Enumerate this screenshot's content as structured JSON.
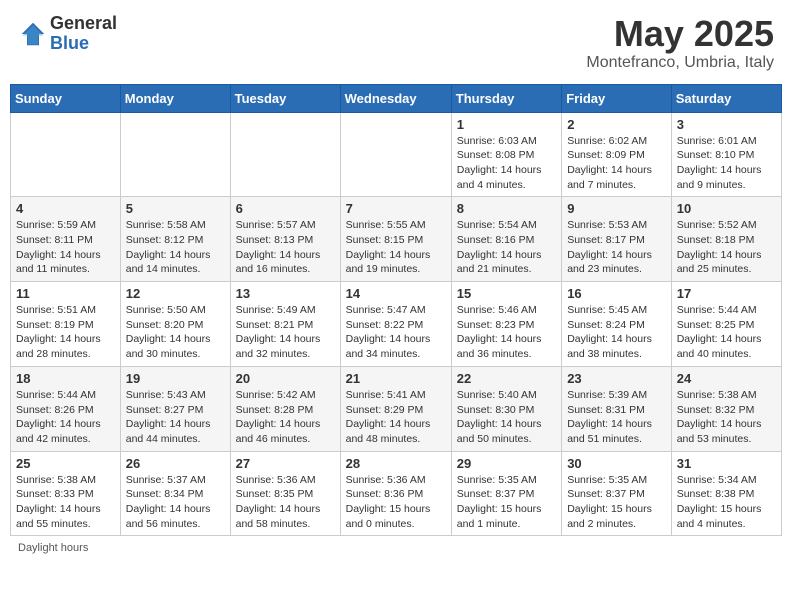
{
  "header": {
    "logo_general": "General",
    "logo_blue": "Blue",
    "title": "May 2025",
    "location": "Montefranco, Umbria, Italy"
  },
  "weekdays": [
    "Sunday",
    "Monday",
    "Tuesday",
    "Wednesday",
    "Thursday",
    "Friday",
    "Saturday"
  ],
  "weeks": [
    [
      {
        "day": "",
        "info": ""
      },
      {
        "day": "",
        "info": ""
      },
      {
        "day": "",
        "info": ""
      },
      {
        "day": "",
        "info": ""
      },
      {
        "day": "1",
        "info": "Sunrise: 6:03 AM\nSunset: 8:08 PM\nDaylight: 14 hours\nand 4 minutes."
      },
      {
        "day": "2",
        "info": "Sunrise: 6:02 AM\nSunset: 8:09 PM\nDaylight: 14 hours\nand 7 minutes."
      },
      {
        "day": "3",
        "info": "Sunrise: 6:01 AM\nSunset: 8:10 PM\nDaylight: 14 hours\nand 9 minutes."
      }
    ],
    [
      {
        "day": "4",
        "info": "Sunrise: 5:59 AM\nSunset: 8:11 PM\nDaylight: 14 hours\nand 11 minutes."
      },
      {
        "day": "5",
        "info": "Sunrise: 5:58 AM\nSunset: 8:12 PM\nDaylight: 14 hours\nand 14 minutes."
      },
      {
        "day": "6",
        "info": "Sunrise: 5:57 AM\nSunset: 8:13 PM\nDaylight: 14 hours\nand 16 minutes."
      },
      {
        "day": "7",
        "info": "Sunrise: 5:55 AM\nSunset: 8:15 PM\nDaylight: 14 hours\nand 19 minutes."
      },
      {
        "day": "8",
        "info": "Sunrise: 5:54 AM\nSunset: 8:16 PM\nDaylight: 14 hours\nand 21 minutes."
      },
      {
        "day": "9",
        "info": "Sunrise: 5:53 AM\nSunset: 8:17 PM\nDaylight: 14 hours\nand 23 minutes."
      },
      {
        "day": "10",
        "info": "Sunrise: 5:52 AM\nSunset: 8:18 PM\nDaylight: 14 hours\nand 25 minutes."
      }
    ],
    [
      {
        "day": "11",
        "info": "Sunrise: 5:51 AM\nSunset: 8:19 PM\nDaylight: 14 hours\nand 28 minutes."
      },
      {
        "day": "12",
        "info": "Sunrise: 5:50 AM\nSunset: 8:20 PM\nDaylight: 14 hours\nand 30 minutes."
      },
      {
        "day": "13",
        "info": "Sunrise: 5:49 AM\nSunset: 8:21 PM\nDaylight: 14 hours\nand 32 minutes."
      },
      {
        "day": "14",
        "info": "Sunrise: 5:47 AM\nSunset: 8:22 PM\nDaylight: 14 hours\nand 34 minutes."
      },
      {
        "day": "15",
        "info": "Sunrise: 5:46 AM\nSunset: 8:23 PM\nDaylight: 14 hours\nand 36 minutes."
      },
      {
        "day": "16",
        "info": "Sunrise: 5:45 AM\nSunset: 8:24 PM\nDaylight: 14 hours\nand 38 minutes."
      },
      {
        "day": "17",
        "info": "Sunrise: 5:44 AM\nSunset: 8:25 PM\nDaylight: 14 hours\nand 40 minutes."
      }
    ],
    [
      {
        "day": "18",
        "info": "Sunrise: 5:44 AM\nSunset: 8:26 PM\nDaylight: 14 hours\nand 42 minutes."
      },
      {
        "day": "19",
        "info": "Sunrise: 5:43 AM\nSunset: 8:27 PM\nDaylight: 14 hours\nand 44 minutes."
      },
      {
        "day": "20",
        "info": "Sunrise: 5:42 AM\nSunset: 8:28 PM\nDaylight: 14 hours\nand 46 minutes."
      },
      {
        "day": "21",
        "info": "Sunrise: 5:41 AM\nSunset: 8:29 PM\nDaylight: 14 hours\nand 48 minutes."
      },
      {
        "day": "22",
        "info": "Sunrise: 5:40 AM\nSunset: 8:30 PM\nDaylight: 14 hours\nand 50 minutes."
      },
      {
        "day": "23",
        "info": "Sunrise: 5:39 AM\nSunset: 8:31 PM\nDaylight: 14 hours\nand 51 minutes."
      },
      {
        "day": "24",
        "info": "Sunrise: 5:38 AM\nSunset: 8:32 PM\nDaylight: 14 hours\nand 53 minutes."
      }
    ],
    [
      {
        "day": "25",
        "info": "Sunrise: 5:38 AM\nSunset: 8:33 PM\nDaylight: 14 hours\nand 55 minutes."
      },
      {
        "day": "26",
        "info": "Sunrise: 5:37 AM\nSunset: 8:34 PM\nDaylight: 14 hours\nand 56 minutes."
      },
      {
        "day": "27",
        "info": "Sunrise: 5:36 AM\nSunset: 8:35 PM\nDaylight: 14 hours\nand 58 minutes."
      },
      {
        "day": "28",
        "info": "Sunrise: 5:36 AM\nSunset: 8:36 PM\nDaylight: 15 hours\nand 0 minutes."
      },
      {
        "day": "29",
        "info": "Sunrise: 5:35 AM\nSunset: 8:37 PM\nDaylight: 15 hours\nand 1 minute."
      },
      {
        "day": "30",
        "info": "Sunrise: 5:35 AM\nSunset: 8:37 PM\nDaylight: 15 hours\nand 2 minutes."
      },
      {
        "day": "31",
        "info": "Sunrise: 5:34 AM\nSunset: 8:38 PM\nDaylight: 15 hours\nand 4 minutes."
      }
    ]
  ],
  "footer": "Daylight hours"
}
